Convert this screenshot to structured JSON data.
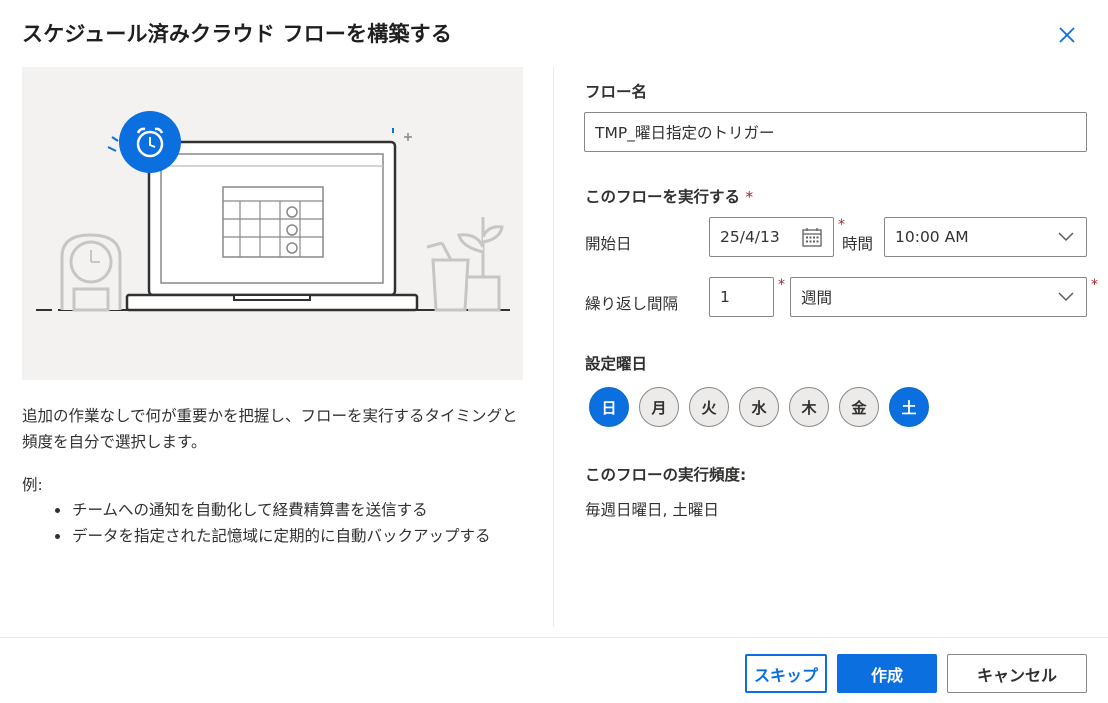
{
  "dialog": {
    "title": "スケジュール済みクラウド フローを構築する",
    "close_icon": "close-icon"
  },
  "left": {
    "description": "追加の作業なしで何が重要かを把握し、フローを実行するタイミングと頻度を自分で選択します。",
    "example_label": "例:",
    "examples": [
      "チームへの通知を自動化して経費精算書を送信する",
      "データを指定された記憶域に定期的に自動バックアップする"
    ]
  },
  "form": {
    "flow_name_label": "フロー名",
    "flow_name_value": "TMP_曜日指定のトリガー",
    "run_label": "このフローを実行する",
    "required_mark": "*",
    "start_date_label": "開始日",
    "start_date_value": "25/4/13",
    "time_label": "時間",
    "time_value": "10:00 AM",
    "repeat_label": "繰り返し間隔",
    "repeat_value": "1",
    "repeat_unit": "週間",
    "days_label": "設定曜日",
    "days": [
      {
        "label": "日",
        "selected": true
      },
      {
        "label": "月",
        "selected": false
      },
      {
        "label": "火",
        "selected": false
      },
      {
        "label": "水",
        "selected": false
      },
      {
        "label": "木",
        "selected": false
      },
      {
        "label": "金",
        "selected": false
      },
      {
        "label": "土",
        "selected": true
      }
    ],
    "frequency_label": "このフローの実行頻度:",
    "frequency_value": "毎週日曜日, 土曜日"
  },
  "footer": {
    "skip_label": "スキップ",
    "create_label": "作成",
    "cancel_label": "キャンセル"
  },
  "colors": {
    "accent": "#0b6fe0",
    "required": "#a4262c",
    "illustration_bg": "#f3f2f1"
  }
}
